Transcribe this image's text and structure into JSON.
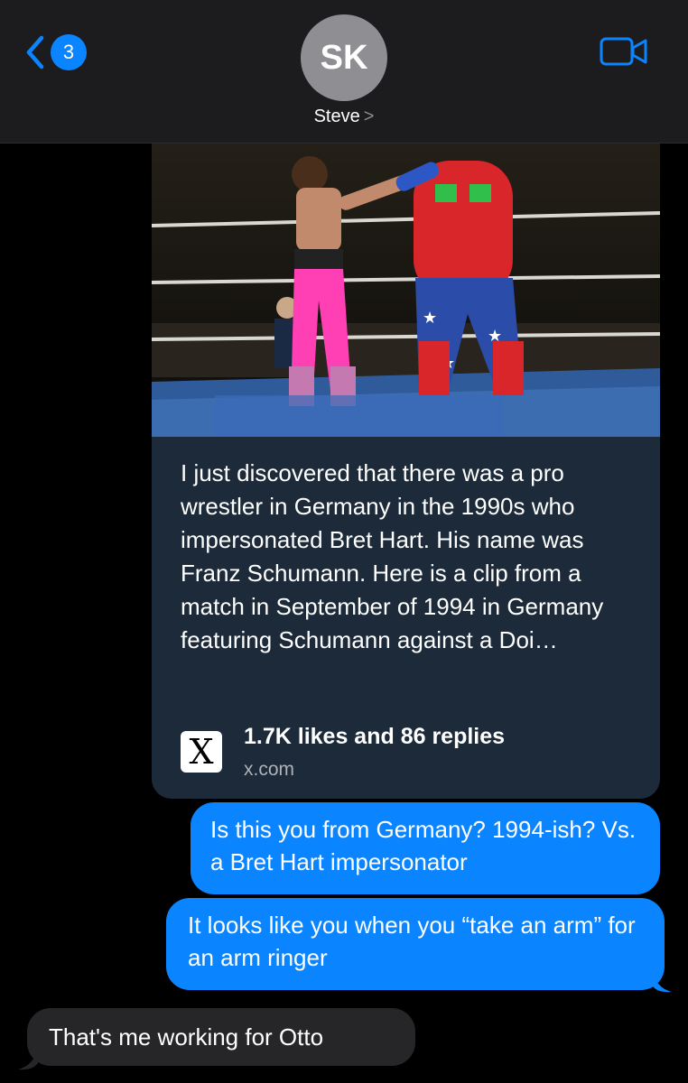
{
  "header": {
    "back_count": "3",
    "avatar_initials": "SK",
    "contact_name": "Steve",
    "contact_chevron": ">"
  },
  "link_preview": {
    "text": "I just discovered that there was a pro wrestler in Germany in the 1990s who impersonated Bret Hart. His name was Franz Schumann. Here is a clip from a match in September of 1994 in Germany featuring Schumann against a Doi…",
    "stats": "1.7K likes and 86 replies",
    "domain": "x.com",
    "logo_letter": "X"
  },
  "messages": [
    {
      "direction": "sent",
      "text": "Is this you from Germany? 1994-ish? Vs. a Bret Hart impersonator"
    },
    {
      "direction": "sent",
      "text": "It looks like you when you “take an arm” for an arm ringer"
    },
    {
      "direction": "received",
      "text": "That's me working for Otto"
    }
  ],
  "colors": {
    "accent": "#0a84ff",
    "sent_bubble": "#0a84ff",
    "received_bubble": "#262628",
    "link_card": "#1c2a3a",
    "header_bg": "#1c1c1e"
  }
}
